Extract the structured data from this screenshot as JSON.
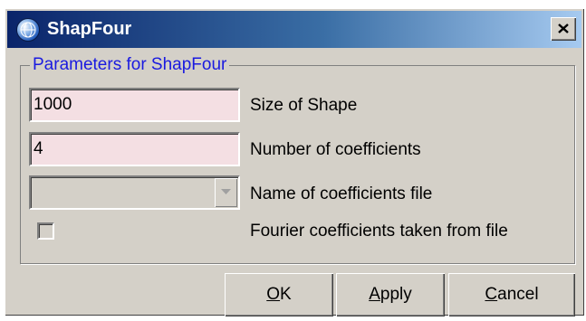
{
  "window": {
    "title": "ShapFour",
    "icon": "app-globe-icon",
    "close_icon": "close-icon"
  },
  "group": {
    "legend": "Parameters for ShapFour"
  },
  "fields": {
    "size": {
      "value": "1000",
      "label": "Size of Shape"
    },
    "coeff_count": {
      "value": "4",
      "label": "Number of coefficients"
    },
    "coeff_file": {
      "value": "",
      "label": "Name of coefficients file",
      "enabled": false
    },
    "fourier_from_file": {
      "checked": false,
      "label": "Fourier coefficients taken from file",
      "enabled": false
    }
  },
  "buttons": {
    "ok": {
      "mnemonic": "O",
      "rest": "K"
    },
    "apply": {
      "mnemonic": "A",
      "rest": "pply"
    },
    "cancel": {
      "mnemonic": "C",
      "rest": "ancel"
    }
  },
  "colors": {
    "title_start": "#0a246a",
    "title_end": "#a6caf0",
    "field_bg": "#f4dfe3",
    "legend_text": "#1a1ae0",
    "window_bg": "#d4d0c8"
  }
}
